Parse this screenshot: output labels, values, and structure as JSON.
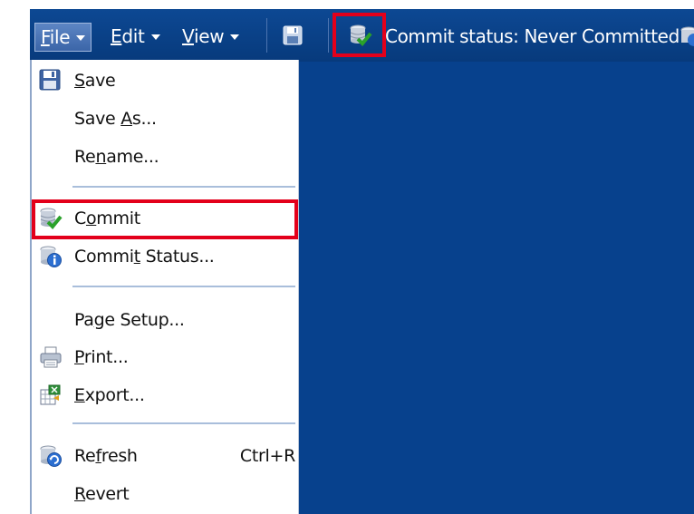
{
  "menubar": {
    "file": {
      "label": "File",
      "mnemonic": "F",
      "rest": "ile"
    },
    "edit": {
      "label": "Edit",
      "mnemonic": "E",
      "rest": "dit"
    },
    "view": {
      "label": "View",
      "mnemonic": "V",
      "rest": "iew"
    }
  },
  "toolbar": {
    "save_icon": "floppy-disk-icon",
    "commit_icon": "database-check-icon",
    "commit_status_text": "Commit status: Never Committed"
  },
  "file_menu": {
    "items": [
      {
        "id": "save",
        "pre": "",
        "mn": "S",
        "post": "ave",
        "icon": "floppy-disk-icon",
        "shortcut": ""
      },
      {
        "id": "save-as",
        "pre": "Save ",
        "mn": "A",
        "post": "s...",
        "icon": "",
        "shortcut": ""
      },
      {
        "id": "rename",
        "pre": "Re",
        "mn": "n",
        "post": "ame...",
        "icon": "",
        "shortcut": ""
      },
      {
        "id": "commit",
        "pre": "C",
        "mn": "o",
        "post": "mmit",
        "icon": "database-check-icon",
        "shortcut": ""
      },
      {
        "id": "commit-status",
        "pre": "Commi",
        "mn": "t",
        "post": " Status...",
        "icon": "database-info-icon",
        "shortcut": ""
      },
      {
        "id": "page-setup",
        "pre": "Pa",
        "mn": "g",
        "post": "e Setup...",
        "icon": "",
        "shortcut": ""
      },
      {
        "id": "print",
        "pre": "",
        "mn": "P",
        "post": "rint...",
        "icon": "printer-icon",
        "shortcut": ""
      },
      {
        "id": "export",
        "pre": "",
        "mn": "E",
        "post": "xport...",
        "icon": "export-spreadsheet-icon",
        "shortcut": ""
      },
      {
        "id": "refresh",
        "pre": "Re",
        "mn": "f",
        "post": "resh",
        "icon": "database-refresh-icon",
        "shortcut": "Ctrl+R"
      },
      {
        "id": "revert",
        "pre": "",
        "mn": "R",
        "post": "evert",
        "icon": "",
        "shortcut": ""
      }
    ]
  },
  "colors": {
    "toolbar_bg": "#0d4893",
    "workspace_bg": "#07418d",
    "highlight": "#e3001b"
  }
}
